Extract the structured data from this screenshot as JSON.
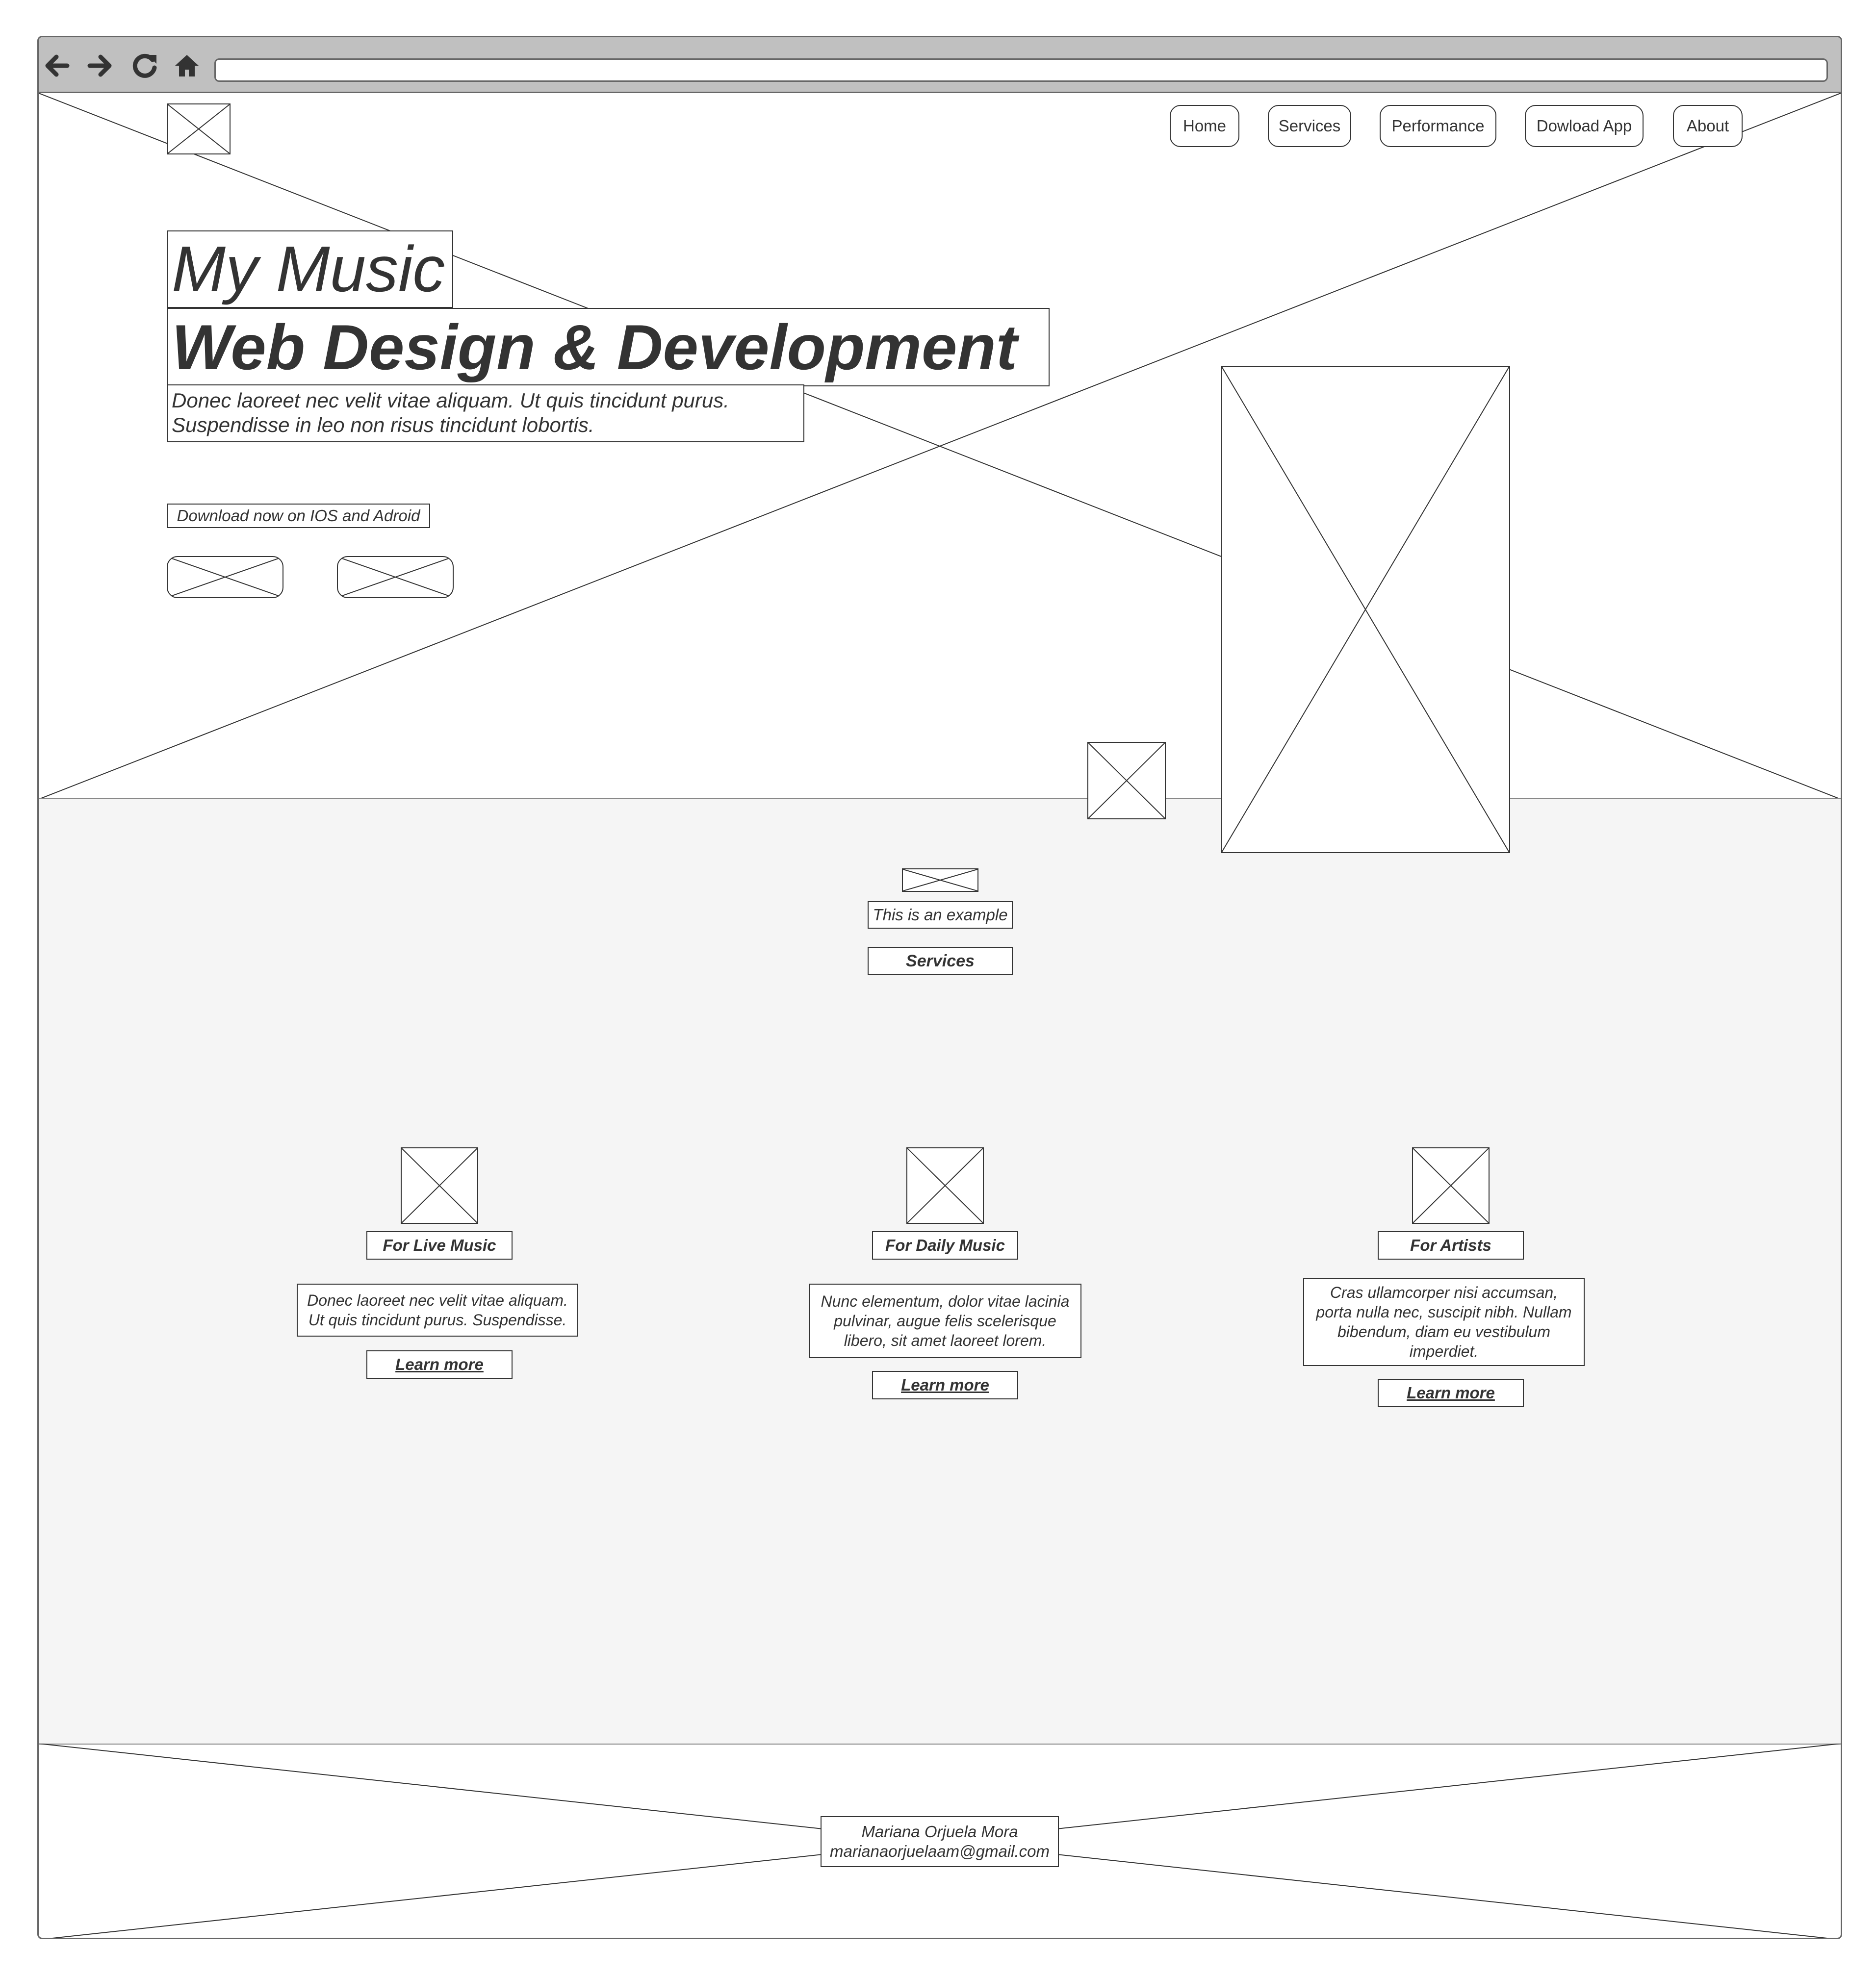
{
  "browser": {
    "nav_icons": [
      "arrow-left-icon",
      "arrow-right-icon",
      "reload-icon",
      "home-icon"
    ],
    "address_value": ""
  },
  "nav": {
    "items": [
      {
        "label": "Home"
      },
      {
        "label": "Services"
      },
      {
        "label": "Performance"
      },
      {
        "label": "Dowload App"
      },
      {
        "label": "About"
      }
    ]
  },
  "hero": {
    "title": "My Music",
    "subtitle": "Web Design & Development",
    "description_line1": "Donec laoreet nec velit vitae aliquam. Ut quis tincidunt purus.",
    "description_line2": "Suspendisse in leo non risus tincidunt lobortis.",
    "download_label": "Download now on IOS and Adroid"
  },
  "services": {
    "example_label": "This is an example",
    "heading": "Services",
    "cards": [
      {
        "title": "For Live Music",
        "text_lines": [
          "Donec laoreet nec velit vitae aliquam.",
          "Ut quis tincidunt purus. Suspendisse."
        ],
        "link": "Learn more"
      },
      {
        "title": "For Daily Music",
        "text_lines": [
          "Nunc elementum, dolor vitae lacinia",
          "pulvinar, augue felis scelerisque",
          "libero, sit amet laoreet lorem."
        ],
        "link": "Learn more"
      },
      {
        "title": "For Artists",
        "text_lines": [
          "Cras ullamcorper nisi accumsan,",
          "porta nulla nec, suscipit nibh. Nullam",
          "bibendum, diam eu vestibulum",
          "imperdiet."
        ],
        "link": "Learn more"
      }
    ]
  },
  "footer": {
    "name": "Mariana Orjuela Mora",
    "email": "marianaorjuelaam@gmail.com"
  },
  "colors": {
    "toolbar": "#c0c0c0",
    "text": "#333333",
    "section_bg": "#f5f5f5"
  }
}
